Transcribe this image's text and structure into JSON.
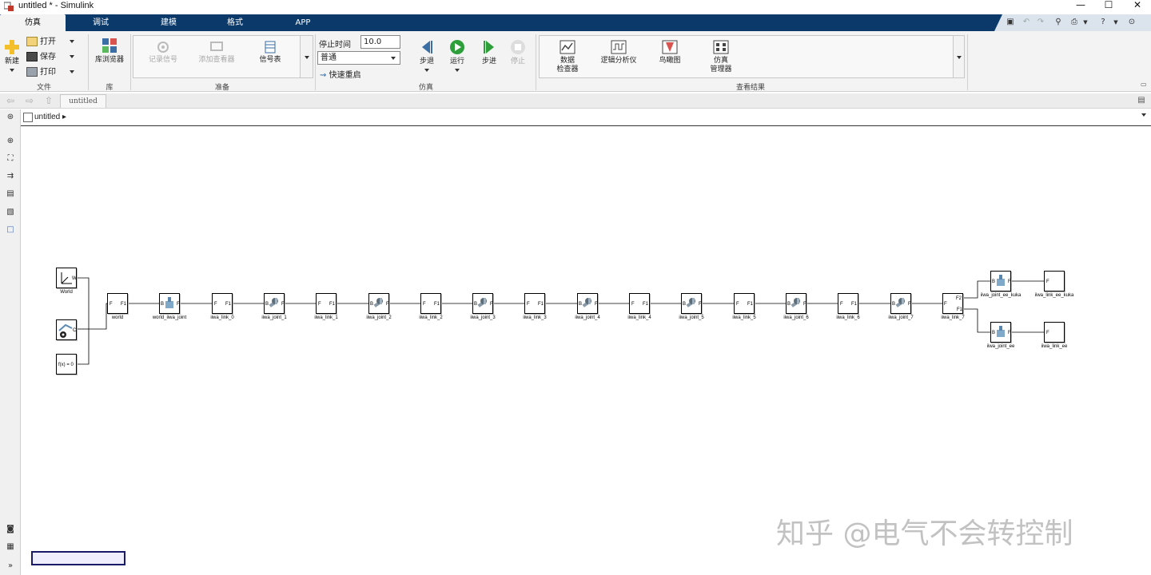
{
  "window": {
    "title": "untitled * - Simulink",
    "minimize": "—",
    "maximize": "☐",
    "close": "✕"
  },
  "tabs": [
    {
      "label": "仿真",
      "active": true
    },
    {
      "label": "调试"
    },
    {
      "label": "建模"
    },
    {
      "label": "格式"
    },
    {
      "label": "APP"
    }
  ],
  "ribbon": {
    "file": {
      "new_label": "新建",
      "open_label": "打开",
      "save_label": "保存",
      "print_label": "打印",
      "group_label": "文件"
    },
    "library": {
      "browser_label": "库浏览器",
      "group_label": "库"
    },
    "prepare": {
      "log_signal_label": "记录信号",
      "add_viewer_label": "添加查看器",
      "signal_table_label": "信号表",
      "group_label": "准备"
    },
    "simulate": {
      "stop_time_label": "停止时间",
      "stop_time_value": "10.0",
      "mode_value": "普通",
      "fast_restart_label": "快速重启",
      "step_back_label": "步退",
      "run_label": "运行",
      "step_forward_label": "步进",
      "stop_label": "停止",
      "group_label": "仿真"
    },
    "review": {
      "data_inspector_line1": "数据",
      "data_inspector_line2": "检查器",
      "logic_analyzer_label": "逻辑分析仪",
      "birds_eye_label": "鸟瞰图",
      "sim_manager_line1": "仿真",
      "sim_manager_line2": "管理器",
      "group_label": "查看结果"
    }
  },
  "nav": {
    "doc_tab": "untitled"
  },
  "breadcrumb": {
    "model": "untitled"
  },
  "blocks": {
    "world_frame": "World",
    "world_port": "W",
    "config_port": "C",
    "solver": "f(x) = 0",
    "chain": [
      "world",
      "world_iiwa_joint",
      "iiwa_link_0",
      "iiwa_joint_1",
      "iiwa_link_1",
      "iiwa_joint_2",
      "iiwa_link_2",
      "iiwa_joint_3",
      "iiwa_link_3",
      "iiwa_joint_4",
      "iiwa_link_4",
      "iiwa_joint_5",
      "iiwa_link_5",
      "iiwa_joint_6",
      "iiwa_link_6",
      "iiwa_joint_7",
      "iiwa_link_7"
    ],
    "branch_top_joint": "iiwa_joint_ee_kuka",
    "branch_top_link": "iiwa_link_ee_kuka",
    "branch_bottom_joint": "iiwa_joint_ee",
    "branch_bottom_link": "iiwa_link_ee",
    "port_f": "F",
    "port_f1": "F1",
    "port_f2": "F2",
    "port_b": "B"
  },
  "watermark": "知乎 @电气不会转控制"
}
